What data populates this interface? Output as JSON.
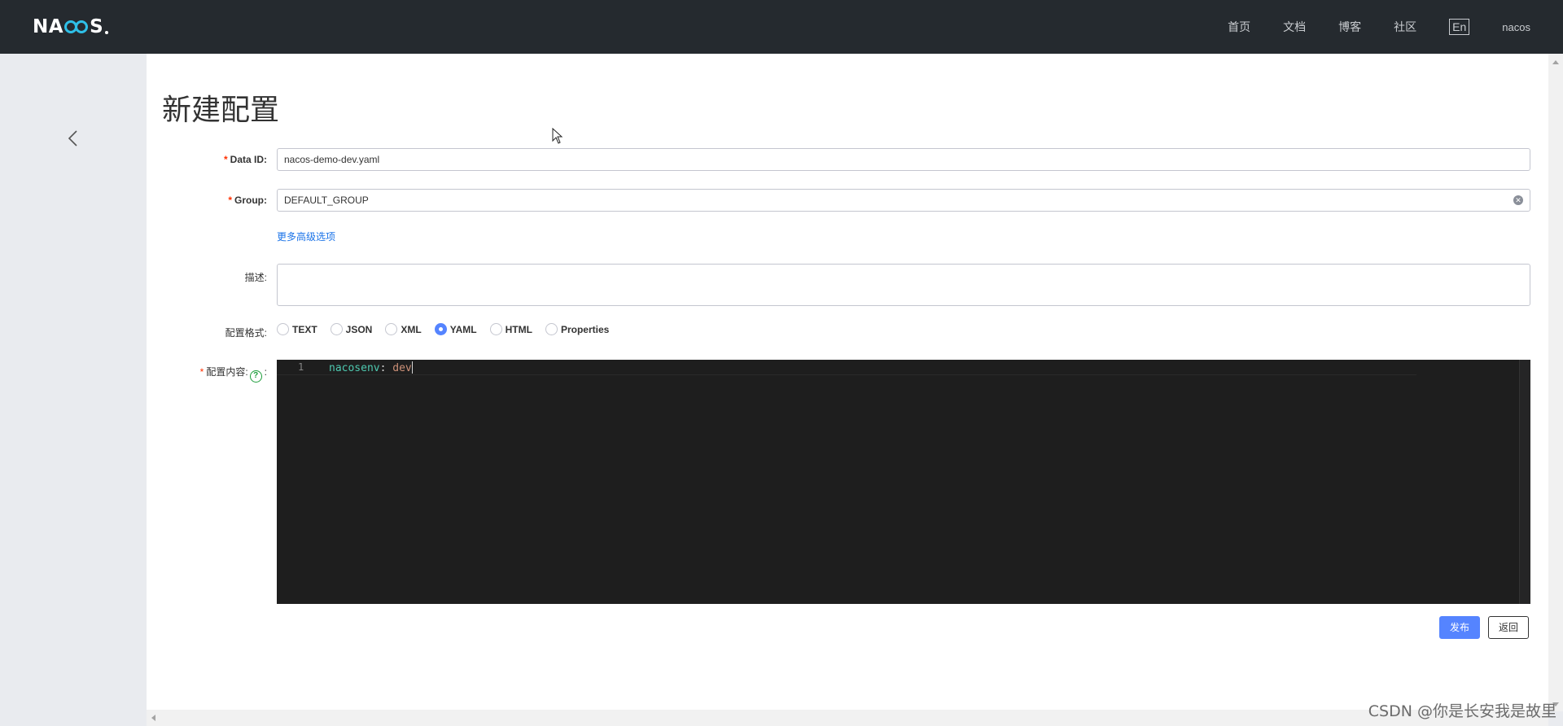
{
  "header": {
    "logo_text": "NACOS.",
    "nav": [
      "首页",
      "文档",
      "博客",
      "社区"
    ],
    "lang": "En",
    "user": "nacos"
  },
  "page": {
    "title": "新建配置"
  },
  "form": {
    "data_id": {
      "required_mark": "*",
      "label": "Data ID:",
      "value": "nacos-demo-dev.yaml"
    },
    "group": {
      "required_mark": "*",
      "label": "Group:",
      "value": "DEFAULT_GROUP"
    },
    "advanced_link": "更多高级选项",
    "description": {
      "label": "描述:",
      "value": ""
    },
    "format": {
      "label": "配置格式:",
      "options": [
        "TEXT",
        "JSON",
        "XML",
        "YAML",
        "HTML",
        "Properties"
      ],
      "selected": "YAML"
    },
    "content": {
      "required_mark": "*",
      "label": "配置内容:",
      "help_icon": "?",
      "colon": ":",
      "lines": [
        {
          "number": "1",
          "key": "nacosenv",
          "sep": ": ",
          "value": "dev"
        }
      ]
    }
  },
  "buttons": {
    "publish": "发布",
    "back": "返回"
  },
  "watermark": "CSDN @你是长安我是故里",
  "colors": {
    "topbar": "#252a2f",
    "accent": "#5584ff",
    "link": "#1a73e8",
    "required": "#ff3000",
    "editor_bg": "#1e1e1e"
  }
}
